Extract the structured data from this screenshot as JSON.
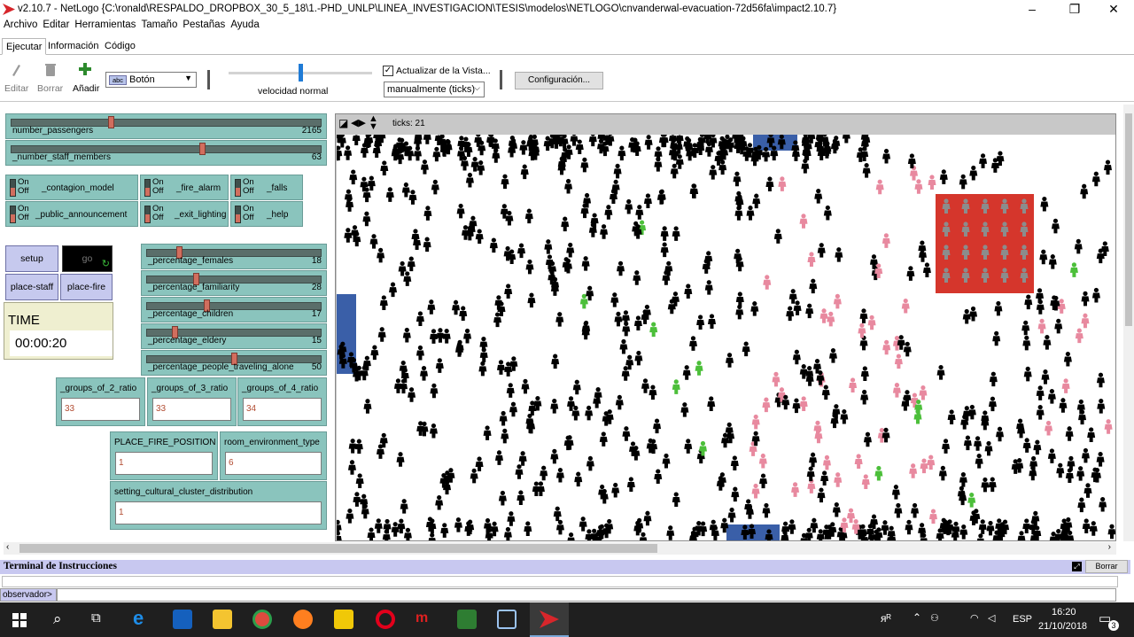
{
  "window": {
    "title": "v2.10.7 - NetLogo {C:\\ronald\\RESPALDO_DROPBOX_30_5_18\\1.-PHD_UNLP\\LINEA_INVESTIGACION\\TESIS\\modelos\\NETLOGO\\cnvanderwal-evacuation-72d56fa\\impact2.10.7}",
    "minimize": "–",
    "maximize": "❐",
    "close": "✕"
  },
  "menu": [
    "Archivo",
    "Editar",
    "Herramientas",
    "Tamaño",
    "Pestañas",
    "Ayuda"
  ],
  "tabs": [
    "Ejecutar",
    "Información",
    "Código"
  ],
  "toolbar": {
    "edit": "Editar",
    "delete": "Borrar",
    "add": "Añadir",
    "widget_type": "Botón",
    "widget_type_badge": "abc",
    "speed_label": "velocidad normal",
    "speed": 0.5,
    "update_view_label": "Actualizar de la Vista...",
    "update_mode": "manualmente (ticks)",
    "settings": "Configuración..."
  },
  "sliders": [
    {
      "name": "number_passengers",
      "value": "2165",
      "fraction": 0.32
    },
    {
      "name": "_number_staff_members",
      "value": "63",
      "fraction": 0.62
    },
    {
      "name": "_percentage_females",
      "value": "18",
      "fraction": 0.18
    },
    {
      "name": "_percentage_familiarity",
      "value": "28",
      "fraction": 0.28
    },
    {
      "name": "_percentage_children",
      "value": "17",
      "fraction": 0.34
    },
    {
      "name": "_percentage_eldery",
      "value": "15",
      "fraction": 0.15
    },
    {
      "name": "_percentage_people_traveling_alone",
      "value": "50",
      "fraction": 0.5
    }
  ],
  "switches": [
    {
      "name": "_contagion_model",
      "on": "On",
      "off": "Off"
    },
    {
      "name": "_fire_alarm",
      "on": "On",
      "off": "Off"
    },
    {
      "name": "_falls",
      "on": "On",
      "off": "Off"
    },
    {
      "name": "_public_announcement",
      "on": "On",
      "off": "Off"
    },
    {
      "name": "_exit_lighting",
      "on": "On",
      "off": "Off"
    },
    {
      "name": "_help",
      "on": "On",
      "off": "Off"
    }
  ],
  "buttons": {
    "setup": "setup",
    "go": "go",
    "place_staff": "place-staff",
    "place_fire": "place-fire"
  },
  "monitor": {
    "label": "TIME",
    "value": "00:00:20"
  },
  "inputs": [
    {
      "name": "_groups_of_2_ratio",
      "value": "33"
    },
    {
      "name": "_groups_of_3_ratio",
      "value": "33"
    },
    {
      "name": "_groups_of_4_ratio",
      "value": "34"
    },
    {
      "name": "PLACE_FIRE_POSITION",
      "value": "1"
    },
    {
      "name": "room_environment_type",
      "value": "6"
    },
    {
      "name": "setting_cultural_cluster_distribution",
      "value": "1"
    }
  ],
  "view": {
    "ticks": "ticks: 21"
  },
  "command_center": {
    "title": "Terminal de Instrucciones",
    "clear": "Borrar",
    "observer": "observador>"
  },
  "taskbar": {
    "lang": "ESP",
    "time": "16:20",
    "date": "21/10/2018",
    "notifications": "3",
    "people_glyph": "ᴙᴿ"
  },
  "colors": {
    "slider": "#8ac4bd",
    "button": "#c6c9ee",
    "monitor": "#efefd0",
    "fire": "#d5362c",
    "agent_black": "#000000",
    "agent_pink": "#e8899f",
    "agent_green": "#4cbf3a"
  }
}
